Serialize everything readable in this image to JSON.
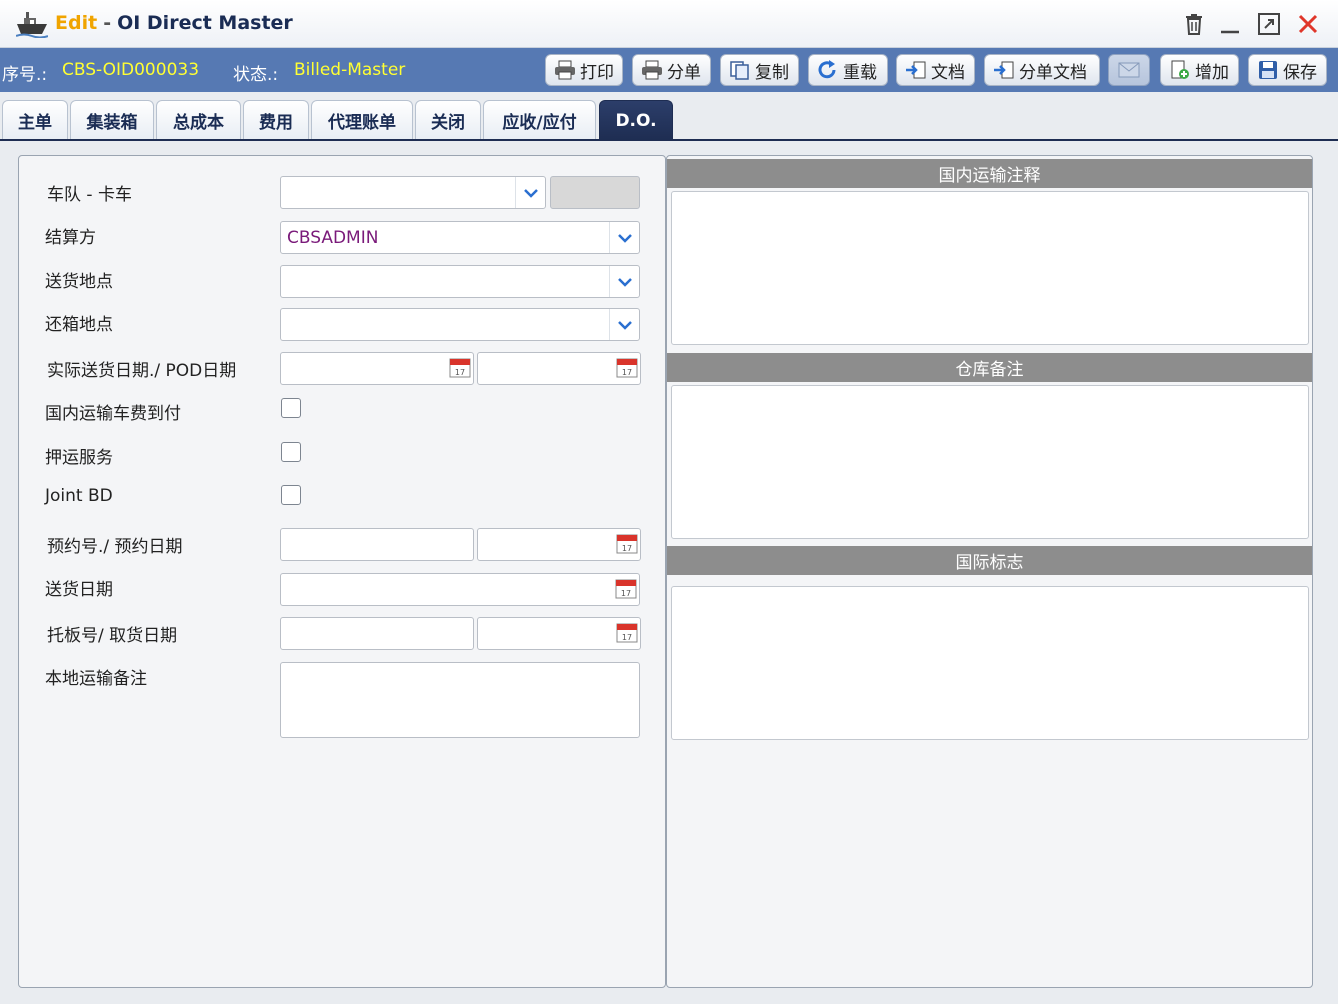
{
  "window": {
    "mode": "Edit",
    "separator": "-",
    "title": "OI Direct Master"
  },
  "info": {
    "serial_label": "序号.:",
    "serial_value": "CBS-OID000033",
    "status_label": "状态.:",
    "status_value": "Billed-Master"
  },
  "toolbar": {
    "print": "打印",
    "house": "分单",
    "copy": "复制",
    "reload": "重载",
    "docs": "文档",
    "house_docs": "分单文档",
    "add": "增加",
    "save": "保存"
  },
  "tabs": [
    "主单",
    "集装箱",
    "总成本",
    "费用",
    "代理账单",
    "关闭",
    "应收/应付",
    "D.O."
  ],
  "form": {
    "fleet_truck_label": "车队 - 卡车",
    "billing_party_label": "结算方",
    "billing_party_value": "CBSADMIN",
    "delivery_location_label": "送货地点",
    "return_location_label": "还箱地点",
    "actual_delivery_pod_label": "实际送货日期./ POD日期",
    "domestic_freight_collect_label": "国内运输车费到付",
    "escort_service_label": "押运服务",
    "joint_bd_label": "Joint BD",
    "booking_label": "预约号./ 预约日期",
    "delivery_date_label": "送货日期",
    "pallet_pickup_label": "托板号/ 取货日期",
    "local_remarks_label": "本地运输备注"
  },
  "sections": {
    "domestic_remarks": "国内运输注释",
    "warehouse_remarks": "仓库备注",
    "international_marks": "国际标志"
  },
  "colors": {
    "info_bar": "#5679b3",
    "highlight_value": "#ffff33",
    "active_tab": "#1e2d52",
    "section_header": "#8d8d8d",
    "edit_mode": "#f0a400"
  }
}
